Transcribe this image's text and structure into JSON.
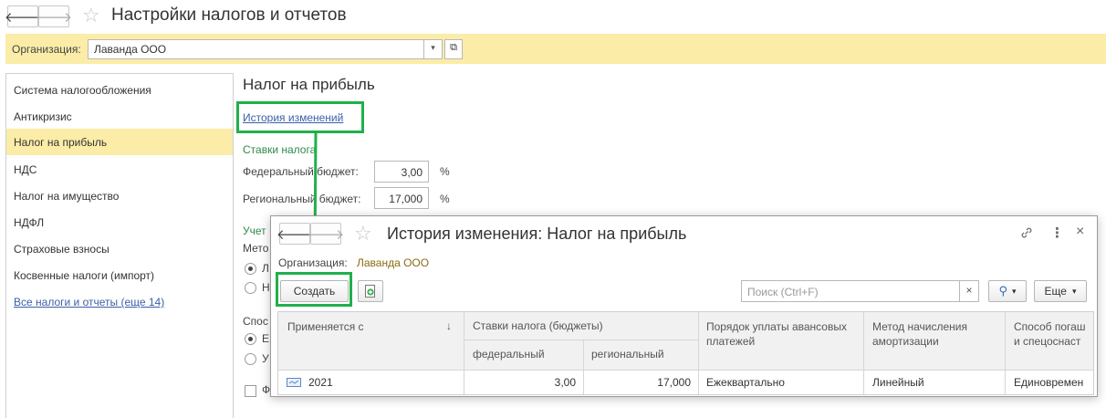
{
  "window": {
    "title": "Настройки налогов и отчетов",
    "back_icon": "arrow-left",
    "forward_icon": "arrow-right",
    "favorite_icon": "star"
  },
  "org_bar": {
    "label": "Организация:",
    "value": "Лаванда ООО"
  },
  "sidebar": {
    "items": [
      {
        "label": "Система налогообложения"
      },
      {
        "label": "Антикризис"
      },
      {
        "label": "Налог на прибыль"
      },
      {
        "label": "НДС"
      },
      {
        "label": "Налог на имущество"
      },
      {
        "label": "НДФЛ"
      },
      {
        "label": "Страховые взносы"
      },
      {
        "label": "Косвенные налоги (импорт)"
      }
    ],
    "more_link": "Все налоги и отчеты (еще 14)",
    "active_index": 2
  },
  "main": {
    "heading": "Налог на прибыль",
    "history_link": "История изменений",
    "rates_section": "Ставки налога",
    "federal_label": "Федеральный бюджет:",
    "federal_value": "3,00",
    "regional_label": "Региональный бюджет:",
    "regional_value": "17,000",
    "percent": "%",
    "accounting_section_partial": "Учет",
    "method_partial": "Мето",
    "radio1_partial": "Л",
    "radio2_partial": "Н",
    "method2_partial": "Спос",
    "radio3_partial": "Е",
    "radio4_partial": "У",
    "check_partial": "Ф"
  },
  "dialog": {
    "title": "История изменения: Налог на прибыль",
    "org_label": "Организация:",
    "org_value": "Лаванда ООО",
    "create_button": "Создать",
    "search_placeholder": "Поиск (Ctrl+F)",
    "clear_icon": "×",
    "more_button": "Еще",
    "columns": {
      "applies_from": "Применяется с",
      "rates": "Ставки налога (бюджеты)",
      "federal": "федеральный",
      "regional": "региональный",
      "payment_order": "Порядок уплаты авансовых платежей",
      "depreciation": "Метод начисления амортизации",
      "method_partial": "Способ погаш и спецоснаст"
    },
    "rows": [
      {
        "year": "2021",
        "federal": "3,00",
        "regional": "17,000",
        "payment": "Ежеквартально",
        "depreciation": "Линейный",
        "method": "Единовремен"
      }
    ]
  },
  "colors": {
    "accent_yellow": "#fbeca7",
    "highlight_green": "#20b04c",
    "link_blue": "#3b5fa8",
    "section_green": "#2f8a4d"
  }
}
